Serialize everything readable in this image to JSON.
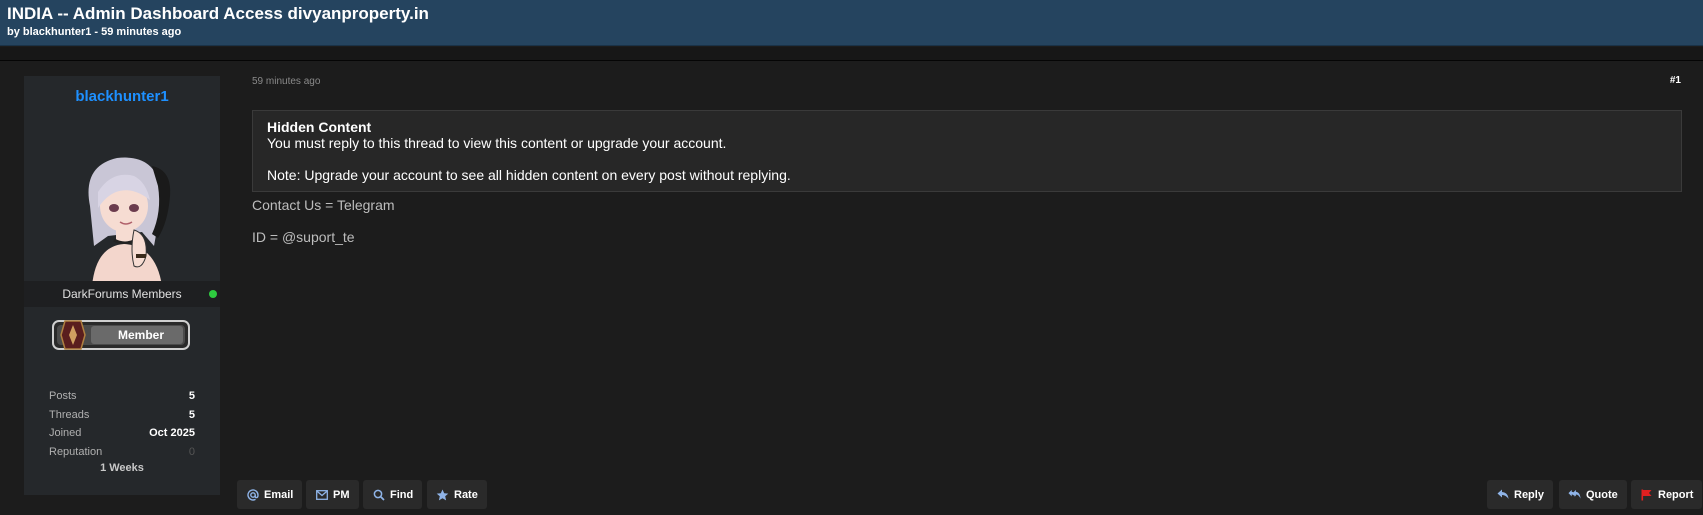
{
  "thread": {
    "title": "INDIA -- Admin Dashboard Access divyanproperty.in",
    "meta": "by blackhunter1 - 59 minutes ago"
  },
  "author": {
    "username": "blackhunter1",
    "group": "DarkForums Members",
    "rank_label": "Member",
    "status": "online",
    "stats": [
      {
        "label": "Posts",
        "value": "5"
      },
      {
        "label": "Threads",
        "value": "5"
      },
      {
        "label": "Joined",
        "value": "Oct 2025"
      },
      {
        "label": "Reputation",
        "value": "0"
      }
    ],
    "time_online": "1 Weeks"
  },
  "post": {
    "time": "59 minutes ago",
    "number": "#1",
    "hidden": {
      "title": "Hidden Content",
      "message": "You must reply to this thread to view this content or upgrade your account.",
      "note": "Note: Upgrade your account to see all hidden content on every post without replying."
    },
    "body": [
      "Contact Us = Telegram",
      "ID = @suport_te"
    ]
  },
  "actions_left": [
    {
      "label": "Email",
      "icon": "at-icon"
    },
    {
      "label": "PM",
      "icon": "envelope-icon"
    },
    {
      "label": "Find",
      "icon": "search-icon"
    },
    {
      "label": "Rate",
      "icon": "star-icon"
    }
  ],
  "actions_right": [
    {
      "label": "Reply",
      "icon": "reply-icon"
    },
    {
      "label": "Quote",
      "icon": "quote-icon"
    },
    {
      "label": "Report",
      "icon": "flag-icon"
    }
  ],
  "colors": {
    "header_bg": "#25445f",
    "username": "#1e90ff",
    "online": "#2ecc40",
    "report_flag": "#e02020",
    "icon_blue": "#8fb4e8"
  }
}
